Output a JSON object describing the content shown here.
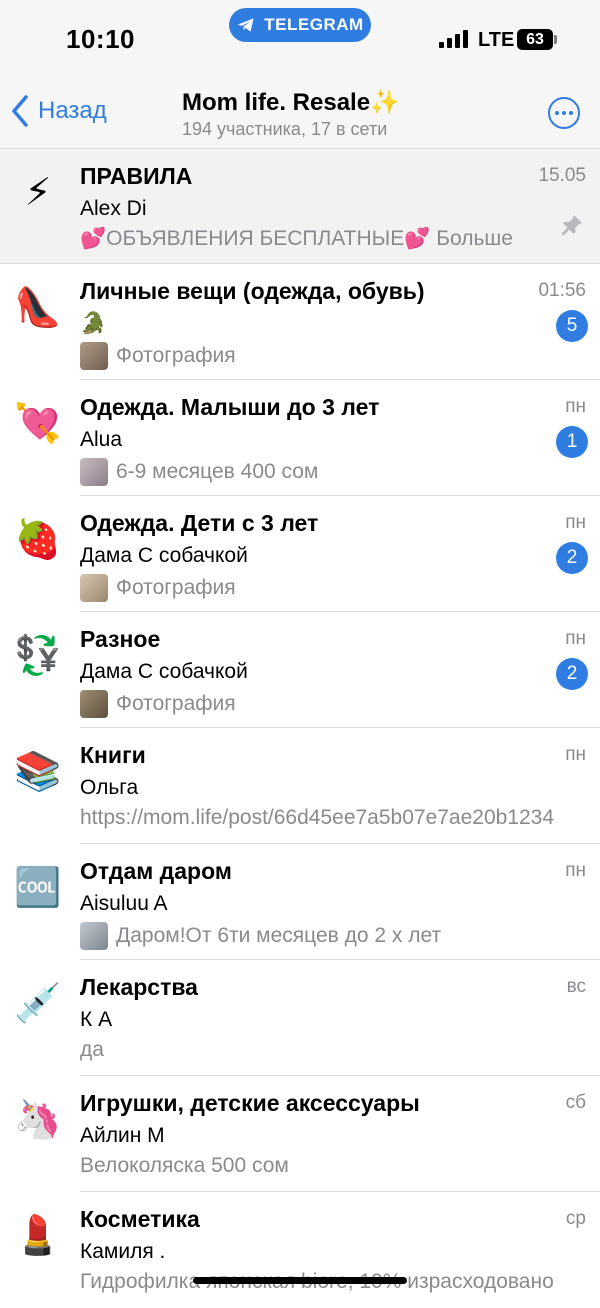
{
  "status_bar": {
    "time": "10:10",
    "telegram_pill": "TELEGRAM",
    "network": "LTE",
    "battery": "63"
  },
  "header": {
    "back_label": "Назад",
    "title": "Mom life. Resale✨",
    "subtitle": "194 участника, 17 в сети"
  },
  "topics": [
    {
      "emoji": "⚡",
      "title": "ПРАВИЛА",
      "time": "15.05",
      "author": "Alex Di",
      "preview": "💕ОБЪЯВЛЕНИЯ БЕСПЛАТНЫЕ💕 Больше",
      "pinned": true
    },
    {
      "emoji": "👠",
      "title": "Личные вещи (одежда, обувь)",
      "time": "01:56",
      "author": "🐊",
      "preview": "Фотография",
      "thumb_color": "#8c7a6a",
      "badge": "5"
    },
    {
      "emoji": "💘",
      "title": "Одежда. Малыши до 3 лет",
      "time": "пн",
      "author": "Alua",
      "preview": "6-9 месяцев 400 сом",
      "thumb_color": "#a99aa3",
      "badge": "1"
    },
    {
      "emoji": "🍓",
      "title": "Одежда. Дети с 3 лет",
      "time": "пн",
      "author": "Дама С собачкой",
      "preview": "Фотография",
      "thumb_color": "#b8a58f",
      "badge": "2"
    },
    {
      "emoji": "💱",
      "title": "Разное",
      "time": "пн",
      "author": "Дама С собачкой",
      "preview": "Фотография",
      "thumb_color": "#7c6e58",
      "badge": "2"
    },
    {
      "emoji": "📚",
      "title": "Книги",
      "time": "пн",
      "author": "Ольга",
      "preview": "https://mom.life/post/66d45ee7a5b07e7ae20b1234"
    },
    {
      "emoji": "🆒",
      "title": "Отдам даром",
      "time": "пн",
      "author": "Aisuluu A",
      "preview": "Даром!От 6ти месяцев до 2 х лет",
      "thumb_color": "#9fa7b0"
    },
    {
      "emoji": "💉",
      "title": "Лекарства",
      "time": "вс",
      "author": "К А",
      "preview": "да"
    },
    {
      "emoji": "🦄",
      "title": "Игрушки, детские аксессуары",
      "time": "сб",
      "author": "Айлин М",
      "preview": "Велоколяска 500 сом"
    },
    {
      "emoji": "💄",
      "title": "Косметика",
      "time": "ср",
      "author": "Камиля .",
      "preview": "Гидрофилка японская biore, 10% израсходовано"
    }
  ],
  "colors": {
    "accent": "#2f7de1",
    "secondary_text": "#8a8a8e",
    "pinned_bg": "#f2f2f3"
  }
}
